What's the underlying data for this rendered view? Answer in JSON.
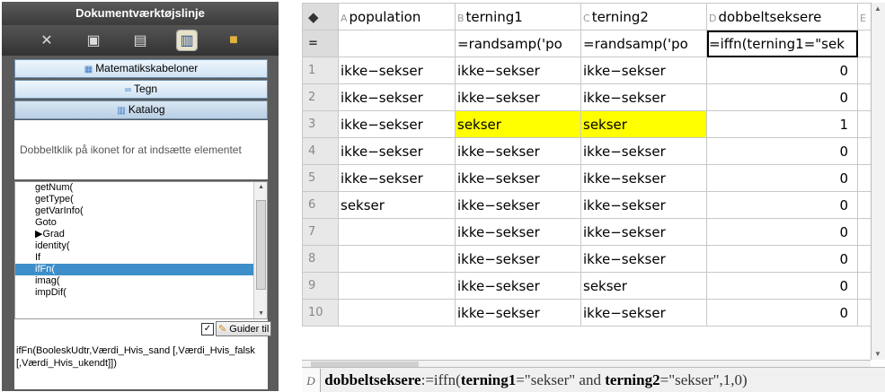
{
  "left_panel": {
    "title": "Dokumentværktøjslinje",
    "toolbar_icons": [
      "tools-icon",
      "calculator-icon",
      "variables-icon",
      "book-icon",
      "folder-icon"
    ],
    "accordion": [
      {
        "label": "Matematikskabeloner",
        "icon": "template-icon"
      },
      {
        "label": "Tegn",
        "icon": "symbols-icon"
      },
      {
        "label": "Katalog",
        "icon": "catalog-icon"
      }
    ],
    "hint": "Dobbeltklik på ikonet for at indsætte elementet",
    "catalog_items": [
      "getNum(",
      "getType(",
      "getVarInfo(",
      "Goto",
      "▶Grad",
      "identity(",
      "If",
      "ifFn(",
      "imag(",
      "impDif("
    ],
    "selected_item": "ifFn(",
    "wizard_label": "Guider til",
    "syntax_text": "ifFn(BooleskUdtr,Værdi_Hvis_sand [,Værdi_Hvis_falsk [,Værdi_Hvis_ukendt]])"
  },
  "sheet": {
    "columns": [
      {
        "letter": "A",
        "name": "population"
      },
      {
        "letter": "B",
        "name": "terning1"
      },
      {
        "letter": "C",
        "name": "terning2"
      },
      {
        "letter": "D",
        "name": "dobbeltseksere"
      },
      {
        "letter": "E",
        "name": ""
      }
    ],
    "formula_row_label": "=",
    "formulas": [
      "",
      "=randsamp('po",
      "=randsamp('po",
      "=iffn(terning1=\"sek",
      ""
    ],
    "rows": [
      {
        "n": "1",
        "cells": [
          "ikke−sekser",
          "ikke−sekser",
          "ikke−sekser",
          "0"
        ]
      },
      {
        "n": "2",
        "cells": [
          "ikke−sekser",
          "ikke−sekser",
          "ikke−sekser",
          "0"
        ]
      },
      {
        "n": "3",
        "cells": [
          "ikke−sekser",
          "sekser",
          "sekser",
          "1"
        ]
      },
      {
        "n": "4",
        "cells": [
          "ikke−sekser",
          "ikke−sekser",
          "ikke−sekser",
          "0"
        ]
      },
      {
        "n": "5",
        "cells": [
          "ikke−sekser",
          "ikke−sekser",
          "ikke−sekser",
          "0"
        ]
      },
      {
        "n": "6",
        "cells": [
          "sekser",
          "ikke−sekser",
          "ikke−sekser",
          "0"
        ]
      },
      {
        "n": "7",
        "cells": [
          "",
          "ikke−sekser",
          "ikke−sekser",
          "0"
        ]
      },
      {
        "n": "8",
        "cells": [
          "",
          "ikke−sekser",
          "ikke−sekser",
          "0"
        ]
      },
      {
        "n": "9",
        "cells": [
          "",
          "ikke−sekser",
          "sekser",
          "0"
        ]
      },
      {
        "n": "10",
        "cells": [
          "",
          "ikke−sekser",
          "ikke−sekser",
          "0"
        ]
      }
    ],
    "highlight_color": "#ffff00",
    "entry_line": {
      "cell": "D",
      "var": "dobbeltseksere",
      "op": ":=iffn(",
      "a1": "terning1",
      "a2": "=\"sekser\" and ",
      "a3": "terning2",
      "a4": "=\"sekser\",1,0)"
    }
  }
}
